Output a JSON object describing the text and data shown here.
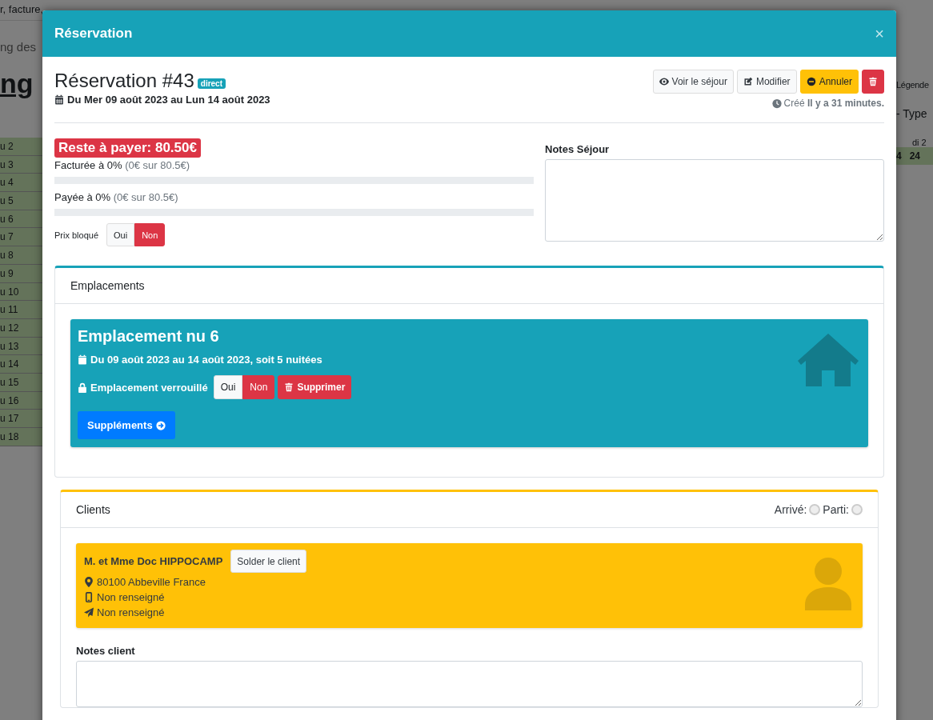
{
  "background": {
    "top_text": "r, facture,",
    "breadcrumb": "ng des",
    "heading": "ng",
    "rows": [
      "u 2",
      "u 3",
      "u 4",
      "u 5",
      "u 6",
      "u 7",
      "u 8",
      "u 9",
      "u 10",
      "u 11",
      "u 12",
      "u 13",
      "u 14",
      "u 15",
      "u 16",
      "u 17",
      "u 18"
    ],
    "legend": "Légende",
    "type_filter": "- Type",
    "day_header": "di 2",
    "day_cells": [
      "4",
      "24"
    ]
  },
  "modal": {
    "title": "Réservation",
    "close": "×",
    "reservation": {
      "title": "Réservation #43",
      "badge": "direct",
      "dates": "Du Mer 09 août 2023 au Lun 14 août 2023",
      "actions": [
        {
          "kind": "view",
          "label": "Voir le séjour"
        },
        {
          "kind": "edit",
          "label": "Modifier"
        },
        {
          "kind": "cancel",
          "label": "Annuler"
        },
        {
          "kind": "delete"
        }
      ],
      "created": "Créé **Il y a 31 minutes.**"
    },
    "balance": "Reste à payer: 80.50€",
    "progress": [
      {
        "label": "Facturée à 0%",
        "detail": "(0€ sur 80.5€)",
        "level": 0
      },
      {
        "label": "Payée à 0%",
        "detail": "(0€ sur 80.5€)",
        "level": 0
      }
    ],
    "price_locked": {
      "label": "Prix bloqué",
      "options": [
        {
          "label": "Oui",
          "selected": false
        },
        {
          "label": "Non",
          "selected": true
        }
      ]
    },
    "notes_sejour": {
      "label": "Notes Séjour"
    },
    "emplacements": {
      "header": "Emplacements",
      "title": "Emplacement nu 6",
      "dates": "Du 09 août 2023 au 14 août 2023, soit 5 nuitées",
      "lock_label": "Emplacement verrouillé",
      "lock_options": [
        {
          "label": "Oui",
          "selected": false
        },
        {
          "label": "Non",
          "selected": true
        }
      ],
      "delete_label": "Supprimer",
      "supplements": "Suppléments"
    },
    "clients": {
      "header": "Clients",
      "arrived_label": "Arrivé:",
      "arrived": false,
      "departed_label": "Parti:",
      "departed": false,
      "name": "M. et Mme Doc HIPPOCAMP",
      "solder": "Solder le client",
      "address": "80100 Abbeville France",
      "phone": "Non renseigné",
      "email": "Non renseigné",
      "notes_label": "Notes client"
    }
  }
}
